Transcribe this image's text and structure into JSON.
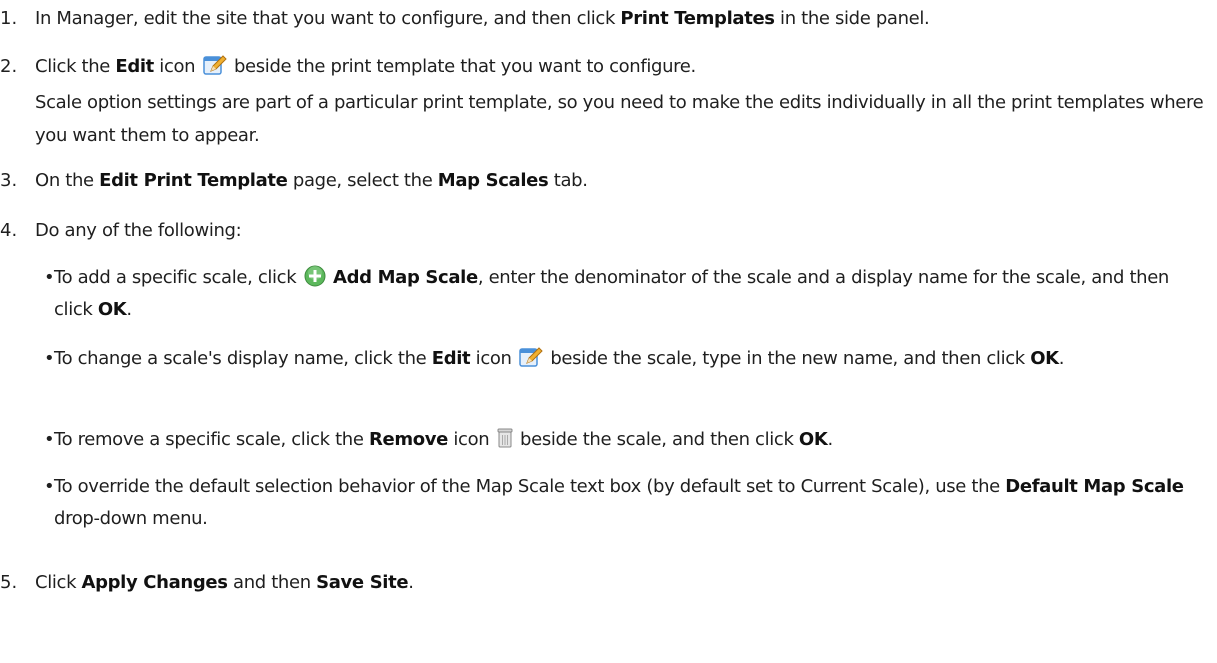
{
  "steps": [
    {
      "number": "1.",
      "text_a": "In Manager, edit the site that you want to configure, and then click ",
      "bold_a": "Print Templates",
      "text_b": " in the side panel."
    },
    {
      "number": "2.",
      "text_a": "Click the ",
      "bold_a": "Edit",
      "text_b": " icon ",
      "icon": "edit-pencil-icon",
      "text_c": " beside the print template that you want to configure.",
      "note": "Scale option settings are part of a particular print template, so you need to make the edits individually in all the print templates where you want them to appear."
    },
    {
      "number": "3.",
      "text_a": "On the ",
      "bold_a": "Edit Print Template",
      "text_b": " page, select the ",
      "bold_b": "Map Scales",
      "text_c": " tab."
    },
    {
      "number": "4.",
      "text_a": "Do any of the following:",
      "bullets": [
        {
          "text_a": "To add a specific scale, click ",
          "icon": "add-circle-icon",
          "bold_a": "Add Map Scale",
          "text_b": ", enter the denominator of the scale and a display name for the scale, and then click ",
          "bold_b": "OK",
          "text_c": "."
        },
        {
          "text_a": "To change a scale's display name, click the ",
          "bold_a": "Edit",
          "text_b": " icon ",
          "icon": "edit-pencil-icon",
          "text_c": " beside the scale, type in the new name, and then click ",
          "bold_b": "OK",
          "text_d": "."
        },
        {
          "text_a": "To remove a specific scale, click the ",
          "bold_a": "Remove",
          "text_b": " icon ",
          "icon": "trash-can-icon",
          "text_c": " beside the scale, and then click ",
          "bold_b": "OK",
          "text_d": "."
        },
        {
          "text_a": "To override the default selection behavior of the Map Scale text box (by default set to Current Scale), use the ",
          "bold_a": "Default Map Scale",
          "text_b": " drop-down menu."
        }
      ]
    },
    {
      "number": "5.",
      "text_a": "Click ",
      "bold_a": "Apply Changes",
      "text_b": " and then ",
      "bold_b": "Save Site",
      "text_c": "."
    }
  ],
  "colors": {
    "text": "#1f1f1f",
    "add_icon_green": "#5cb85c",
    "edit_icon_blue": "#4a90d9",
    "edit_icon_pencil": "#f0b030",
    "trash_icon_gray": "#c8c8c8"
  }
}
